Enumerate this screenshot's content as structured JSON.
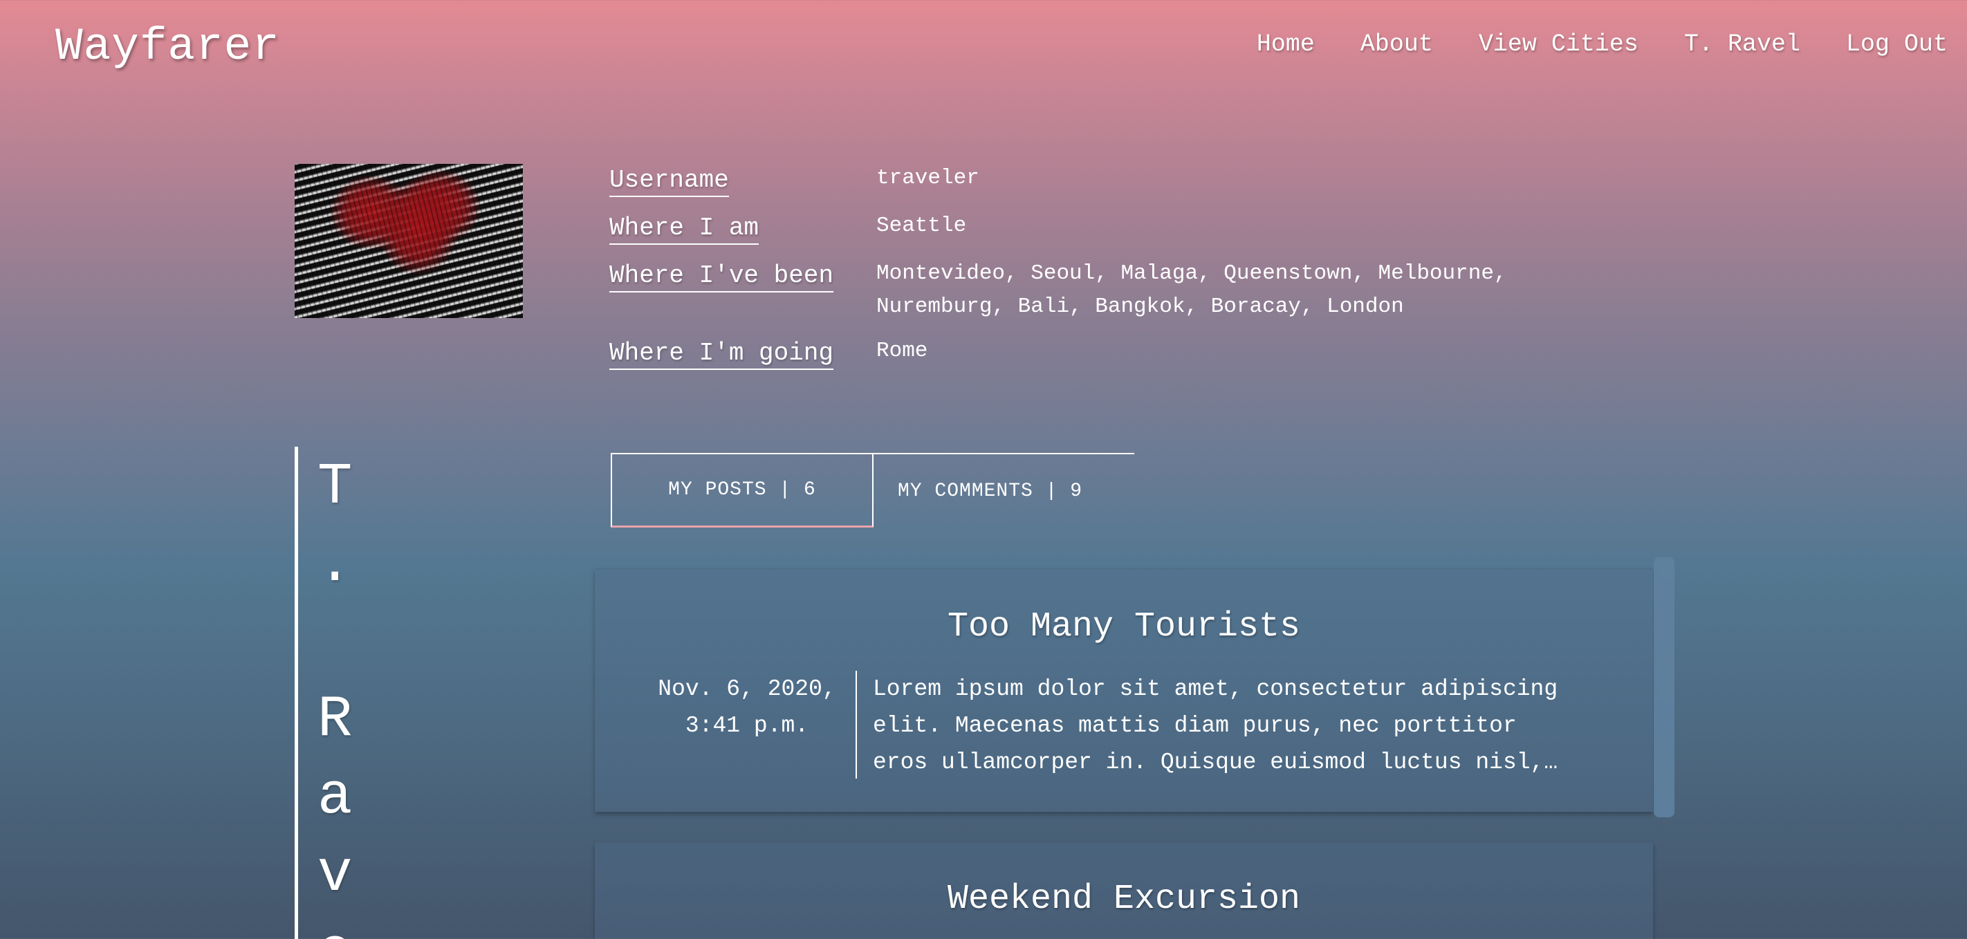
{
  "header": {
    "brand": "Wayfarer",
    "nav": [
      "Home",
      "About",
      "View Cities",
      "T. Ravel",
      "Log Out"
    ]
  },
  "profile": {
    "username_label": "Username",
    "username": "traveler",
    "location_label": "Where I am",
    "location": "Seattle",
    "been_label": "Where I've been",
    "been_line1": "Montevideo, Seoul, Malaga, Queenstown, Melbourne,",
    "been_line2": "Nuremburg, Bali, Bangkok, Boracay, London",
    "going_label": "Where I'm going",
    "going": "Rome",
    "display_name_letters": [
      "T",
      ".",
      "R",
      "a",
      "v",
      "e"
    ]
  },
  "tabs": {
    "posts": "MY POSTS | 6",
    "comments": "MY COMMENTS | 9"
  },
  "posts": [
    {
      "title": "Too Many Tourists",
      "date_line1": "Nov. 6, 2020,",
      "date_line2": "3:41 p.m.",
      "body_line1": "Lorem ipsum dolor sit amet, consectetur adipiscing",
      "body_line2": "elit. Maecenas mattis diam purus, nec porttitor",
      "body_line3": "eros ullamcorper in. Quisque euismod luctus nisl,…"
    },
    {
      "title": "Weekend Excursion"
    }
  ]
}
